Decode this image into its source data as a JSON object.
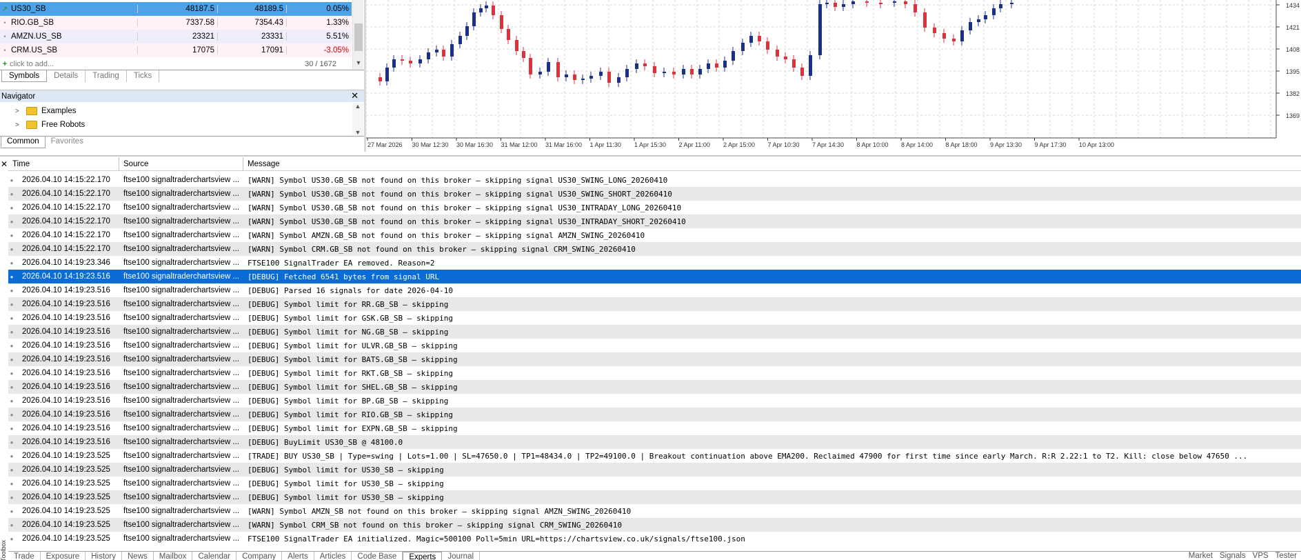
{
  "market_watch": {
    "rows": [
      {
        "symbol": "US30_SB",
        "bid": "48187.5",
        "ask": "48189.5",
        "change": "0.05%",
        "negative": false
      },
      {
        "symbol": "RIO.GB_SB",
        "bid": "7337.58",
        "ask": "7354.43",
        "change": "1.33%",
        "negative": false
      },
      {
        "symbol": "AMZN.US_SB",
        "bid": "23321",
        "ask": "23331",
        "change": "5.51%",
        "negative": false
      },
      {
        "symbol": "CRM.US_SB",
        "bid": "17075",
        "ask": "17091",
        "change": "-3.05%",
        "negative": true
      }
    ],
    "add_label": "click to add...",
    "count": "30 / 1672",
    "tabs": [
      "Symbols",
      "Details",
      "Trading",
      "Ticks"
    ]
  },
  "navigator": {
    "title": "Navigator",
    "items": [
      "Examples",
      "Free Robots"
    ],
    "tabs": [
      "Common",
      "Favorites"
    ]
  },
  "chart": {
    "price_labels": [
      "1434",
      "1421",
      "1408",
      "1395",
      "1382",
      "1369"
    ],
    "time_labels": [
      "27 Mar 2026",
      "30 Mar 12:30",
      "30 Mar 16:30",
      "31 Mar 12:00",
      "31 Mar 16:00",
      "1 Apr 11:30",
      "1 Apr 15:30",
      "2 Apr 11:00",
      "2 Apr 15:00",
      "7 Apr 10:30",
      "7 Apr 14:30",
      "8 Apr 10:00",
      "8 Apr 14:00",
      "8 Apr 18:00",
      "9 Apr 13:30",
      "9 Apr 17:30",
      "10 Apr 13:00"
    ],
    "colors": {
      "bull": "#1c2f8c",
      "bear": "#e0303c"
    }
  },
  "log": {
    "headers": {
      "time": "Time",
      "source": "Source",
      "message": "Message"
    },
    "rows": [
      {
        "time": "2026.04.10 14:15:22.170",
        "source": "ftse100 signaltraderchartsview ...",
        "message": "[WARN] Symbol US30.GB_SB not found on this broker — skipping signal US30_SWING_LONG_20260410"
      },
      {
        "time": "2026.04.10 14:15:22.170",
        "source": "ftse100 signaltraderchartsview ...",
        "message": "[WARN] Symbol US30.GB_SB not found on this broker — skipping signal US30_SWING_SHORT_20260410"
      },
      {
        "time": "2026.04.10 14:15:22.170",
        "source": "ftse100 signaltraderchartsview ...",
        "message": "[WARN] Symbol US30.GB_SB not found on this broker — skipping signal US30_INTRADAY_LONG_20260410"
      },
      {
        "time": "2026.04.10 14:15:22.170",
        "source": "ftse100 signaltraderchartsview ...",
        "message": "[WARN] Symbol US30.GB_SB not found on this broker — skipping signal US30_INTRADAY_SHORT_20260410"
      },
      {
        "time": "2026.04.10 14:15:22.170",
        "source": "ftse100 signaltraderchartsview ...",
        "message": "[WARN] Symbol AMZN.GB_SB not found on this broker — skipping signal AMZN_SWING_20260410"
      },
      {
        "time": "2026.04.10 14:15:22.170",
        "source": "ftse100 signaltraderchartsview ...",
        "message": "[WARN] Symbol CRM.GB_SB not found on this broker — skipping signal CRM_SWING_20260410"
      },
      {
        "time": "2026.04.10 14:19:23.346",
        "source": "ftse100 signaltraderchartsview ...",
        "message": "FTSE100 SignalTrader EA removed. Reason=2"
      },
      {
        "time": "2026.04.10 14:19:23.516",
        "source": "ftse100 signaltraderchartsview ...",
        "message": "[DEBUG] Fetched 6541 bytes from signal URL",
        "selected": true
      },
      {
        "time": "2026.04.10 14:19:23.516",
        "source": "ftse100 signaltraderchartsview ...",
        "message": "[DEBUG] Parsed 16 signals for date 2026-04-10"
      },
      {
        "time": "2026.04.10 14:19:23.516",
        "source": "ftse100 signaltraderchartsview ...",
        "message": "[DEBUG] Symbol limit for RR.GB_SB — skipping"
      },
      {
        "time": "2026.04.10 14:19:23.516",
        "source": "ftse100 signaltraderchartsview ...",
        "message": "[DEBUG] Symbol limit for GSK.GB_SB — skipping"
      },
      {
        "time": "2026.04.10 14:19:23.516",
        "source": "ftse100 signaltraderchartsview ...",
        "message": "[DEBUG] Symbol limit for NG.GB_SB — skipping"
      },
      {
        "time": "2026.04.10 14:19:23.516",
        "source": "ftse100 signaltraderchartsview ...",
        "message": "[DEBUG] Symbol limit for ULVR.GB_SB — skipping"
      },
      {
        "time": "2026.04.10 14:19:23.516",
        "source": "ftse100 signaltraderchartsview ...",
        "message": "[DEBUG] Symbol limit for BATS.GB_SB — skipping"
      },
      {
        "time": "2026.04.10 14:19:23.516",
        "source": "ftse100 signaltraderchartsview ...",
        "message": "[DEBUG] Symbol limit for RKT.GB_SB — skipping"
      },
      {
        "time": "2026.04.10 14:19:23.516",
        "source": "ftse100 signaltraderchartsview ...",
        "message": "[DEBUG] Symbol limit for SHEL.GB_SB — skipping"
      },
      {
        "time": "2026.04.10 14:19:23.516",
        "source": "ftse100 signaltraderchartsview ...",
        "message": "[DEBUG] Symbol limit for BP.GB_SB — skipping"
      },
      {
        "time": "2026.04.10 14:19:23.516",
        "source": "ftse100 signaltraderchartsview ...",
        "message": "[DEBUG] Symbol limit for RIO.GB_SB — skipping"
      },
      {
        "time": "2026.04.10 14:19:23.516",
        "source": "ftse100 signaltraderchartsview ...",
        "message": "[DEBUG] Symbol limit for EXPN.GB_SB — skipping"
      },
      {
        "time": "2026.04.10 14:19:23.516",
        "source": "ftse100 signaltraderchartsview ...",
        "message": "[DEBUG] BuyLimit US30_SB @ 48100.0"
      },
      {
        "time": "2026.04.10 14:19:23.525",
        "source": "ftse100 signaltraderchartsview ...",
        "message": "[TRADE] BUY US30_SB | Type=swing | Lots=1.00 | SL=47650.0 | TP1=48434.0 | TP2=49100.0 | Breakout continuation above EMA200. Reclaimed 47900 for first time since early March. R:R 2.22:1 to T2. Kill: close below 47650 ..."
      },
      {
        "time": "2026.04.10 14:19:23.525",
        "source": "ftse100 signaltraderchartsview ...",
        "message": "[DEBUG] Symbol limit for US30_SB — skipping"
      },
      {
        "time": "2026.04.10 14:19:23.525",
        "source": "ftse100 signaltraderchartsview ...",
        "message": "[DEBUG] Symbol limit for US30_SB — skipping"
      },
      {
        "time": "2026.04.10 14:19:23.525",
        "source": "ftse100 signaltraderchartsview ...",
        "message": "[DEBUG] Symbol limit for US30_SB — skipping"
      },
      {
        "time": "2026.04.10 14:19:23.525",
        "source": "ftse100 signaltraderchartsview ...",
        "message": "[WARN] Symbol AMZN_SB not found on this broker — skipping signal AMZN_SWING_20260410"
      },
      {
        "time": "2026.04.10 14:19:23.525",
        "source": "ftse100 signaltraderchartsview ...",
        "message": "[WARN] Symbol CRM_SB not found on this broker — skipping signal CRM_SWING_20260410"
      },
      {
        "time": "2026.04.10 14:19:23.525",
        "source": "ftse100 signaltraderchartsview ...",
        "message": "FTSE100 SignalTrader EA initialized. Magic=500100 Poll=5min URL=https://chartsview.co.uk/signals/ftse100.json"
      }
    ]
  },
  "toolbox": {
    "side_label": "Toolbox",
    "tabs": [
      "Trade",
      "Exposure",
      "History",
      "News",
      "Mailbox",
      "Calendar",
      "Company",
      "Alerts",
      "Articles",
      "Code Base",
      "Experts",
      "Journal"
    ],
    "active_tab": "Experts",
    "right_items": [
      "Market",
      "Signals",
      "VPS",
      "Tester"
    ]
  }
}
